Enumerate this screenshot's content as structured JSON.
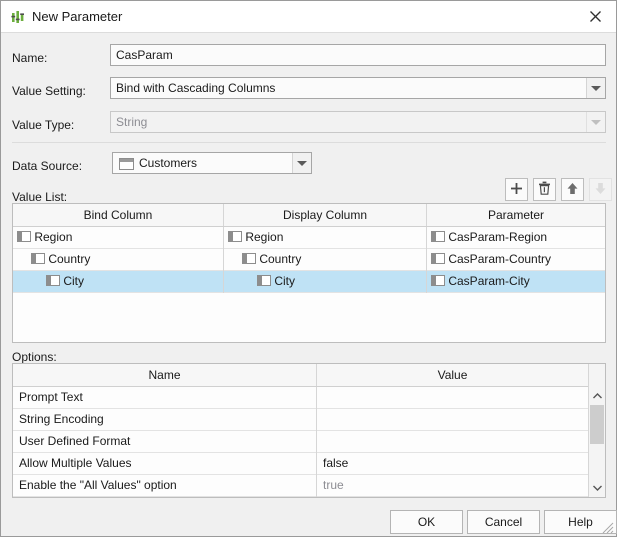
{
  "window": {
    "title": "New Parameter",
    "icon": "parameter-bars-icon",
    "close_icon": "close-icon"
  },
  "form": {
    "name": {
      "label": "Name:",
      "value": "CasParam"
    },
    "value_setting": {
      "label": "Value Setting:",
      "value": "Bind with Cascading Columns"
    },
    "value_type": {
      "label": "Value Type:",
      "value": "String",
      "disabled": true
    },
    "data_source": {
      "label": "Data Source:",
      "value": "Customers",
      "icon": "table-icon"
    }
  },
  "value_list": {
    "label": "Value List:",
    "toolbar": [
      {
        "name": "add-button",
        "icon": "plus-icon",
        "enabled": true
      },
      {
        "name": "delete-button",
        "icon": "trash-icon",
        "enabled": true
      },
      {
        "name": "move-up-button",
        "icon": "arrow-up-icon",
        "enabled": true
      },
      {
        "name": "move-down-button",
        "icon": "arrow-down-icon",
        "enabled": false
      }
    ],
    "columns": [
      "Bind Column",
      "Display Column",
      "Parameter"
    ],
    "rows": [
      {
        "bind": "Region",
        "display": "Region",
        "parameter": "CasParam-Region",
        "indent": 0,
        "selected": false
      },
      {
        "bind": "Country",
        "display": "Country",
        "parameter": "CasParam-Country",
        "indent": 1,
        "selected": false
      },
      {
        "bind": "City",
        "display": "City",
        "parameter": "CasParam-City",
        "indent": 2,
        "selected": true
      }
    ]
  },
  "options": {
    "label": "Options:",
    "columns": [
      "Name",
      "Value"
    ],
    "rows": [
      {
        "name": "Prompt Text",
        "value": "",
        "muted": false
      },
      {
        "name": "String Encoding",
        "value": "",
        "muted": false
      },
      {
        "name": "User Defined Format",
        "value": "",
        "muted": false
      },
      {
        "name": "Allow Multiple Values",
        "value": "false",
        "muted": false
      },
      {
        "name": "Enable the \"All Values\" option",
        "value": "true",
        "muted": true
      }
    ],
    "scrollbar": {
      "up_icon": "chevron-up-icon",
      "down_icon": "chevron-down-icon"
    }
  },
  "buttons": {
    "ok": "OK",
    "cancel": "Cancel",
    "help": "Help"
  },
  "colors": {
    "selection": "#bfe2f5",
    "accent_icon": "#6cae3e"
  }
}
